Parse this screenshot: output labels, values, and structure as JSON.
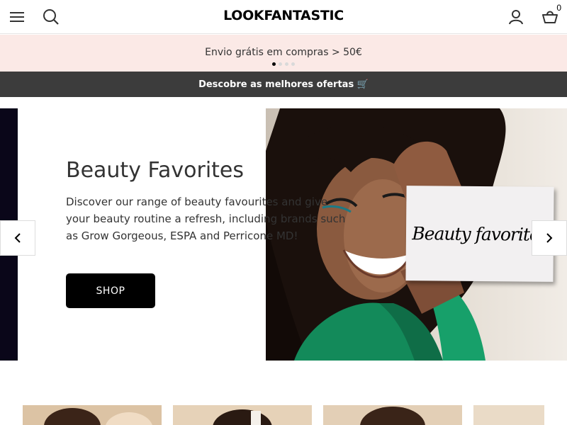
{
  "header": {
    "logo": "LOOKFANTASTIC",
    "basket_count": "0",
    "icons": [
      "menu-icon",
      "search-icon",
      "account-icon",
      "basket-icon"
    ]
  },
  "promo": {
    "text": "Envio grátis em compras > 50€",
    "slides": 4,
    "active_slide": 1
  },
  "offers": {
    "text": "Descobre as melhores ofertas 🛒"
  },
  "hero": {
    "title": "Beauty Favorites",
    "description": "Discover our range of beauty favourites and give your beauty routine a refresh, including brands such as Grow Gorgeous, ESPA and Perricone MD!",
    "button_label": "SHOP",
    "card_text": "Beauty favorites",
    "icons": [
      "chevron-left-icon",
      "chevron-right-icon"
    ]
  },
  "colors": {
    "promo_bg": "#fbe9e6",
    "offers_bg": "#3c3c3c",
    "button_bg": "#000000",
    "hero_strip": "#0a0619"
  }
}
